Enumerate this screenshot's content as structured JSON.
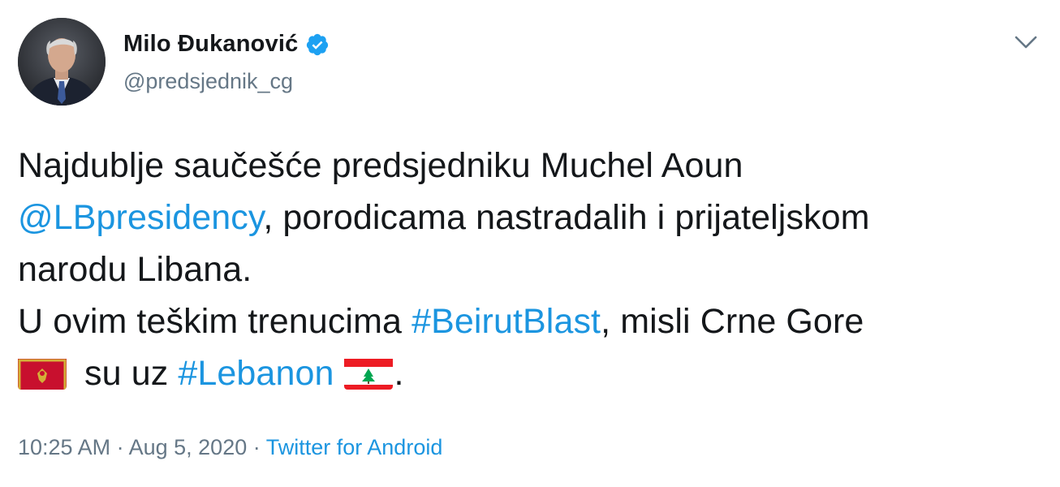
{
  "user": {
    "name": "Milo Đukanović",
    "handle": "@predsjednik_cg",
    "verified": true
  },
  "tweet": {
    "line1": "Najdublje saučešće predsjedniku Muchel Aoun",
    "mention": "@LBpresidency",
    "line2_rest": ", porodicama nastradalih i prijateljskom",
    "line3": "narodu Libana.",
    "line4_start": "U ovim teškim trenucima ",
    "hashtag1": "#BeirutBlast",
    "line4_rest": ", misli Crne Gore",
    "line5_mid": " su uz ",
    "hashtag2": "#Lebanon",
    "line5_end": "."
  },
  "meta": {
    "time": "10:25 AM",
    "sep1": " · ",
    "date": "Aug 5, 2020",
    "sep2": " · ",
    "source": "Twitter for Android"
  },
  "icons": {
    "verified": "verified-badge-icon",
    "caret": "chevron-down-icon",
    "flag1": "montenegro-flag-icon",
    "flag2": "lebanon-flag-icon"
  },
  "colors": {
    "link": "#1b95e0",
    "secondary_text": "#657786",
    "primary_text": "#14171a"
  }
}
